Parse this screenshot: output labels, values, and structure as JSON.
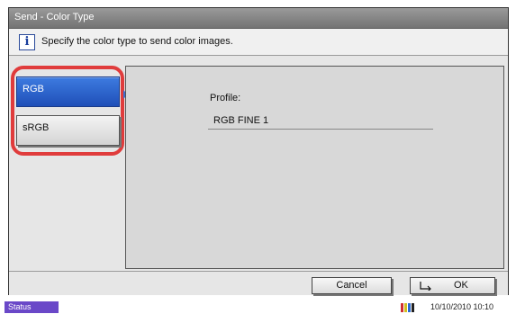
{
  "window": {
    "title": "Send - Color Type"
  },
  "info": {
    "icon": "info-icon",
    "icon_glyph": "i",
    "message": "Specify the color type to send color images."
  },
  "color_types": [
    {
      "label": "RGB",
      "selected": true
    },
    {
      "label": "sRGB",
      "selected": false
    }
  ],
  "profile": {
    "label": "Profile:",
    "value": "RGB FINE 1"
  },
  "buttons": {
    "cancel": "Cancel",
    "ok": "OK"
  },
  "status": {
    "label": "Status",
    "datetime": "10/10/2010  10:10"
  },
  "colors": {
    "accent": "#1f4fb8",
    "highlight": "#e03c3c",
    "status": "#6a48c8"
  }
}
